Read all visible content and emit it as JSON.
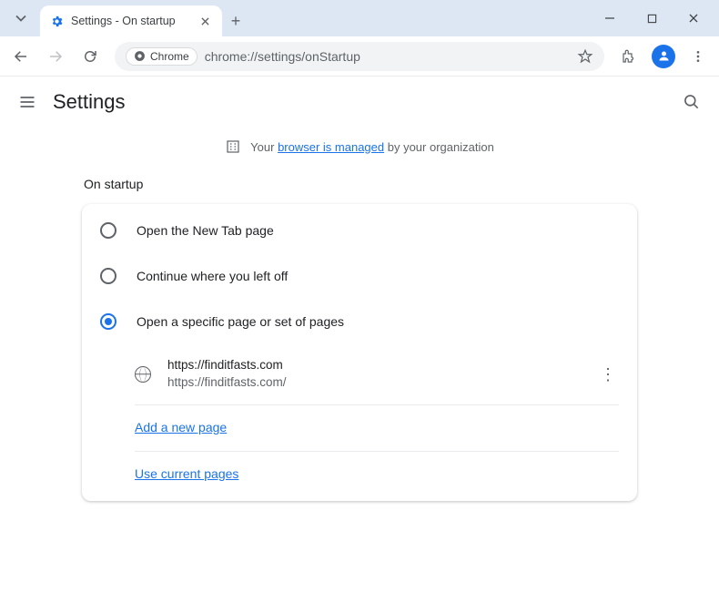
{
  "tab": {
    "title": "Settings - On startup"
  },
  "omnibox": {
    "chip": "Chrome",
    "url": "chrome://settings/onStartup"
  },
  "header": {
    "title": "Settings"
  },
  "managed": {
    "prefix": "Your ",
    "link": "browser is managed",
    "suffix": " by your organization"
  },
  "section": {
    "title": "On startup"
  },
  "options": [
    {
      "label": "Open the New Tab page",
      "selected": false
    },
    {
      "label": "Continue where you left off",
      "selected": false
    },
    {
      "label": "Open a specific page or set of pages",
      "selected": true
    }
  ],
  "pages": [
    {
      "title": "https://finditfasts.com",
      "url": "https://finditfasts.com/"
    }
  ],
  "actions": {
    "add_page": "Add a new page",
    "use_current": "Use current pages"
  }
}
